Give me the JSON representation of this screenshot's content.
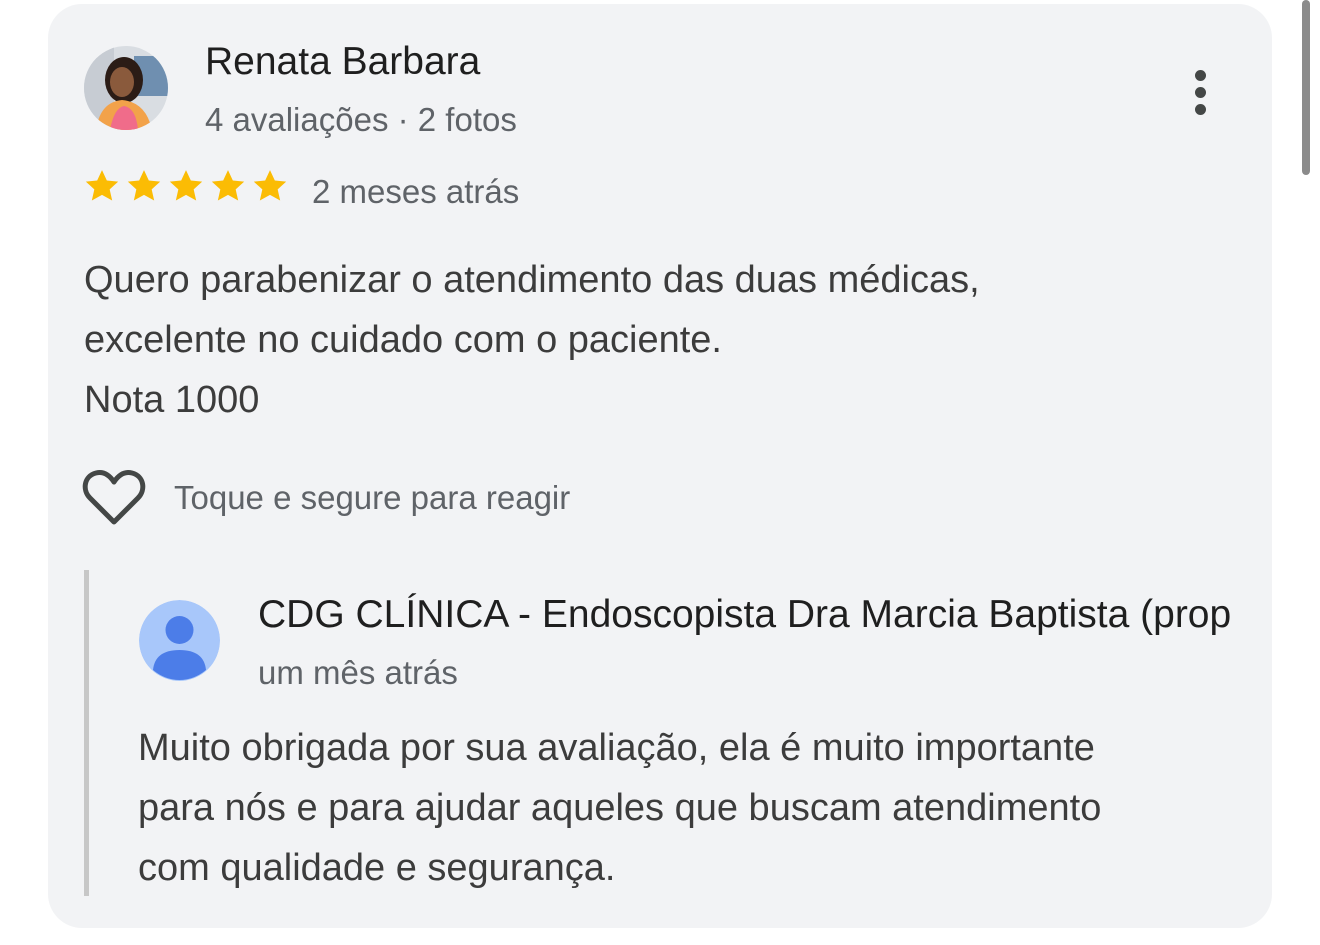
{
  "review": {
    "author_name": "Renata Barbara",
    "author_meta": "4 avaliações · 2 fotos",
    "rating": 5,
    "rating_max": 5,
    "star_color": "#fbbc04",
    "date": "2 meses atrás",
    "text_lines": [
      "Quero parabenizar o atendimento das duas médicas,",
      "excelente no cuidado com o paciente.",
      "Nota 1000"
    ],
    "more_icon": "more-vert-icon"
  },
  "reaction": {
    "icon": "heart-outline-icon",
    "label": "Toque e segure para reagir"
  },
  "owner_reply": {
    "owner_name": "CDG CLÍNICA - Endoscopista Dra Marcia Baptista (prop",
    "date": "um mês atrás",
    "avatar_color": "#a8c7fa",
    "text_lines": [
      "Muito obrigada por sua avaliação, ela é muito importante",
      "para nós e para ajudar aqueles que buscam atendimento",
      "com qualidade e segurança."
    ]
  }
}
